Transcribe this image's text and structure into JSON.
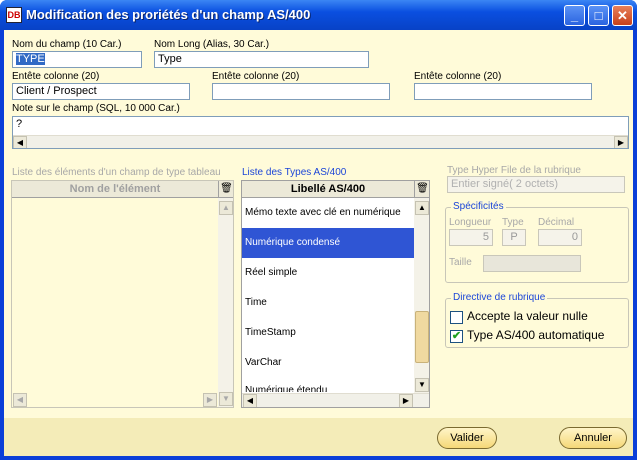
{
  "window": {
    "title": "Modification des proriétés d'un champ AS/400",
    "icon": "dbx-app-icon",
    "controls": {
      "minimize": "_",
      "maximize": "□",
      "close": "✕"
    }
  },
  "form": {
    "nom_champ": {
      "label": "Nom du champ (10 Car.)",
      "value": "TYPE"
    },
    "nom_long": {
      "label": "Nom Long (Alias, 30 Car.)",
      "value": "Type"
    },
    "entete1": {
      "label": "Entête colonne (20)",
      "value": "Client / Prospect"
    },
    "entete2": {
      "label": "Entête colonne (20)",
      "value": ""
    },
    "entete3": {
      "label": "Entête colonne (20)",
      "value": ""
    },
    "note": {
      "label": "Note sur le champ (SQL, 10 000 Car.)",
      "value": "?"
    }
  },
  "elements_list": {
    "caption": "Liste des éléments d'un champ de type tableau",
    "header": "Nom de l'élément"
  },
  "types_list": {
    "caption": "Liste des Types AS/400",
    "header": "Libellé AS/400",
    "items": [
      "Mémo texte avec clé en numérique",
      "Numérique condensé",
      "Réel simple",
      "Time",
      "TimeStamp",
      "VarChar",
      "Numérique étendu"
    ],
    "selected_index": 1,
    "scroll_position": 0.88
  },
  "hyperfile": {
    "label": "Type Hyper File de la rubrique",
    "value": "Entier signé( 2 octets)"
  },
  "specificites": {
    "title": "Spécificités",
    "longueur_label": "Longueur",
    "longueur_value": "5",
    "type_label": "Type",
    "type_value": "P",
    "decimal_label": "Décimal",
    "decimal_value": "0",
    "taille_label": "Taille",
    "taille_value": ""
  },
  "directive": {
    "title": "Directive de rubrique",
    "accepte_null": {
      "label": "Accepte la valeur nulle",
      "checked": false
    },
    "type_auto": {
      "label": "Type AS/400 automatique",
      "checked": true,
      "mark": "✔"
    }
  },
  "buttons": {
    "valider": "Valider",
    "annuler": "Annuler"
  },
  "colors": {
    "titlebar": "#0a4fe0",
    "background": "#fffbd9",
    "selection": "#2f55d4",
    "caption_blue": "#1c46d8"
  }
}
